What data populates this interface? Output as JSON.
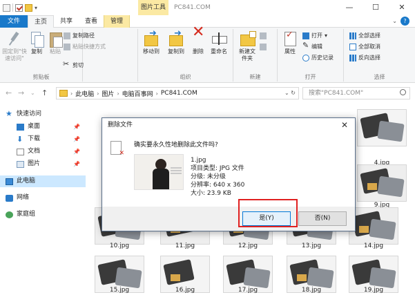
{
  "window": {
    "title": "PC841.COM",
    "context_tab_title": "图片工具",
    "controls": [
      "—",
      "☐",
      "✕"
    ]
  },
  "tabs": [
    {
      "label": "文件"
    },
    {
      "label": "主页"
    },
    {
      "label": "共享"
    },
    {
      "label": "查看"
    },
    {
      "label": "管理"
    }
  ],
  "ribbon": {
    "clipboard": {
      "pin": "固定到\"快速访问\"",
      "copy": "复制",
      "paste": "粘贴",
      "copy_path": "复制路径",
      "paste_shortcut": "粘贴快捷方式",
      "cut": "剪切",
      "label": "剪贴板"
    },
    "organize": {
      "move_to": "移动到",
      "copy_to": "复制到",
      "delete": "删除",
      "rename": "重命名",
      "label": "组织"
    },
    "new": {
      "new_folder": "新建文件夹",
      "label": "新建"
    },
    "open": {
      "properties": "属性",
      "open": "打开",
      "edit": "编辑",
      "history": "历史记录",
      "label": "打开"
    },
    "select": {
      "select_all": "全部选择",
      "select_none": "全部取消",
      "invert": "反向选择",
      "label": "选择"
    }
  },
  "address": {
    "crumbs": [
      "此电脑",
      "图片",
      "电脑百事网",
      "PC841.COM"
    ],
    "search_placeholder": "搜索\"PC841.COM\""
  },
  "nav": {
    "quick_access": "快速访问",
    "items": [
      {
        "label": "桌面",
        "icon": "desktop-icon"
      },
      {
        "label": "下载",
        "icon": "download-icon"
      },
      {
        "label": "文档",
        "icon": "documents-icon"
      },
      {
        "label": "图片",
        "icon": "pictures-icon"
      }
    ],
    "this_pc": "此电脑",
    "network": "网络",
    "homegroup": "家庭组"
  },
  "files": {
    "visible_names": [
      "4.jpg",
      "9.jpg",
      "10.jpg",
      "11.jpg",
      "12.jpg",
      "13.jpg",
      "14.jpg",
      "15.jpg",
      "16.jpg",
      "17.jpg",
      "18.jpg",
      "19.jpg"
    ]
  },
  "dialog": {
    "title": "删除文件",
    "question": "确实要永久性地删除此文件吗?",
    "file_name": "1.jpg",
    "file_type": "项目类型: JPG 文件",
    "rating": "分级: 未分级",
    "resolution": "分辨率: 640 x 360",
    "size": "大小: 23.9 KB",
    "yes": "是(Y)",
    "no": "否(N)"
  }
}
